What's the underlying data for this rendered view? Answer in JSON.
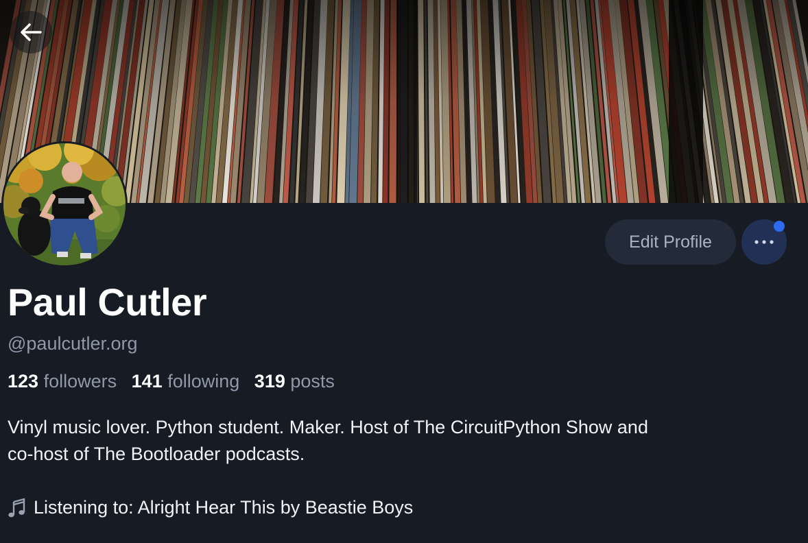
{
  "profile": {
    "display_name": "Paul Cutler",
    "handle": "@paulcutler.org",
    "stats": {
      "followers_count": "123",
      "followers_label": "followers",
      "following_count": "141",
      "following_label": "following",
      "posts_count": "319",
      "posts_label": "posts"
    },
    "bio_line_1": "Vinyl music lover. Python student. Maker. Host of The CircuitPython Show and",
    "bio_line_2": "co-host of The Bootloader podcasts.",
    "listening_text": "Listening to: Alright Hear This by Beastie Boys"
  },
  "actions": {
    "edit_profile_label": "Edit Profile"
  },
  "icons": {
    "back": "arrow-left-icon",
    "more": "ellipsis-icon",
    "music": "music-note-icon"
  },
  "colors": {
    "background": "#161b24",
    "muted_text": "#8f99aa",
    "edit_button_bg": "#232b3a",
    "more_button_bg": "#223056",
    "notification_dot": "#2f6bf0"
  }
}
